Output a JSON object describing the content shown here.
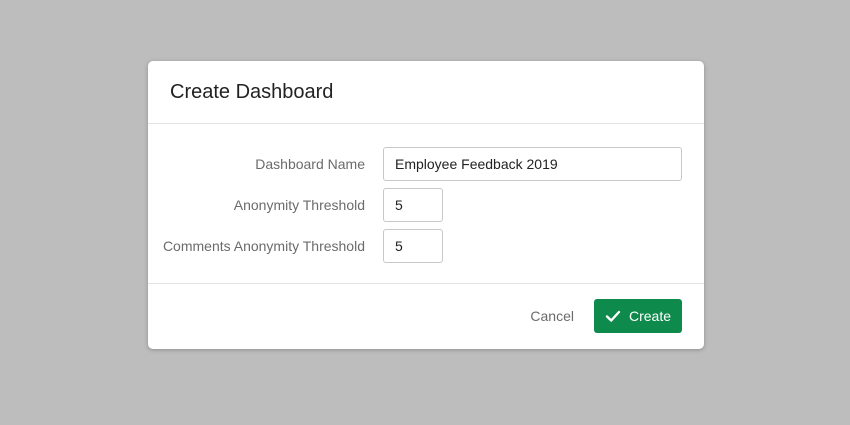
{
  "dialog": {
    "title": "Create Dashboard",
    "fields": {
      "dashboard_name": {
        "label": "Dashboard Name",
        "value": "Employee Feedback 2019"
      },
      "anonymity_threshold": {
        "label": "Anonymity Threshold",
        "value": "5"
      },
      "comments_anonymity_threshold": {
        "label": "Comments Anonymity Threshold",
        "value": "5"
      }
    },
    "footer": {
      "cancel_label": "Cancel",
      "create_label": "Create",
      "create_icon": "check-icon"
    }
  },
  "colors": {
    "backdrop": "#bdbdbd",
    "primary_button": "#0e8a4d",
    "label_text": "#6b6b6b"
  }
}
